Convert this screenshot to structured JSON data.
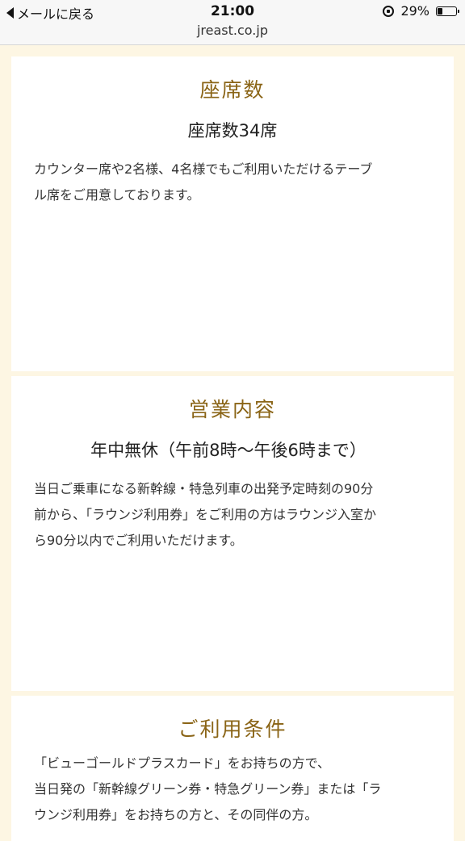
{
  "status_bar": {
    "back_label": "メールに戻る",
    "time": "21:00",
    "url": "jreast.co.jp",
    "battery": "29%",
    "battery_level": 0.29
  },
  "sections": [
    {
      "title": "座席数",
      "subtitle": "座席数34席",
      "lines": [
        "カウンター席や2名様、4名様でもご利用いただけるテーブ",
        "ル席をご用意しております。"
      ]
    },
    {
      "title": "営業内容",
      "subtitle": "年中無休（午前8時〜午後6時まで）",
      "lines": [
        "当日ご乗車になる新幹線・特急列車の出発予定時刻の90分",
        "前から、「ラウンジ利用券」をご利用の方はラウンジ入室か",
        "ら90分以内でご利用いただけます。"
      ]
    },
    {
      "title": "ご利用条件",
      "lines": [
        "「ビューゴールドプラスカード」をお持ちの方で、",
        "当日発の「新幹線グリーン券・特急グリーン券」または「ラ",
        "ウンジ利用券」をお持ちの方と、その同伴の方。"
      ]
    }
  ]
}
